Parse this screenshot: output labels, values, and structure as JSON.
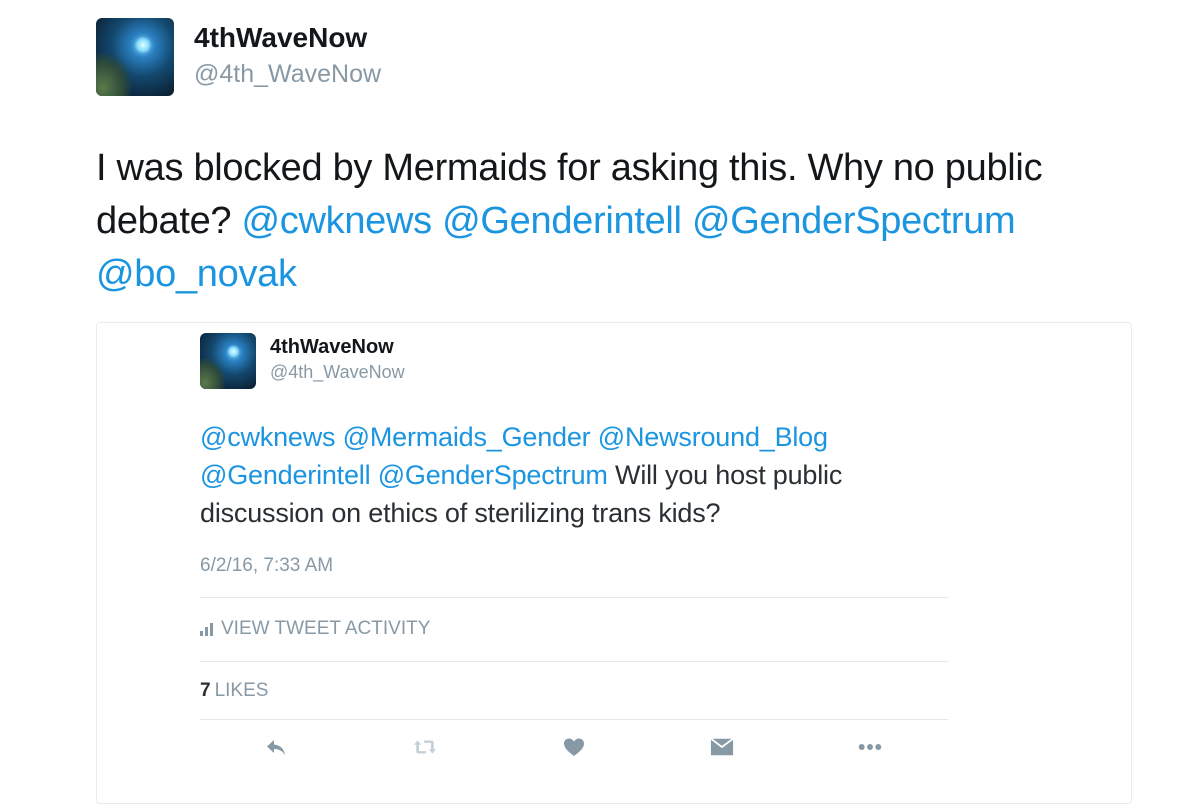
{
  "tweet": {
    "author_name": "4thWaveNow",
    "author_handle": "@4th_WaveNow",
    "text_line1": "I was blocked by Mermaids for asking this. Why no public",
    "text_line2_plain": "debate?",
    "mentions": [
      "@cwknews",
      "@Genderintell",
      "@GenderSpectrum",
      "@bo_novak"
    ]
  },
  "quoted_tweet": {
    "author_name": "4thWaveNow",
    "author_handle": "@4th_WaveNow",
    "mentions_line1": [
      "@cwknews",
      "@Mermaids_Gender",
      "@Newsround_Blog"
    ],
    "mentions_line2": [
      "@Genderintell",
      "@GenderSpectrum"
    ],
    "text_line2_tail": "Will you host public",
    "text_line3": "discussion on ethics of sterilizing trans kids?",
    "timestamp": "6/2/16, 7:33 AM",
    "activity_label": "VIEW TWEET ACTIVITY",
    "likes_count": "7",
    "likes_label": "LIKES"
  },
  "actions": [
    "reply-icon",
    "retweet-icon",
    "like-heart-icon",
    "direct-message-icon",
    "more-dots-icon"
  ],
  "colors": {
    "link": "#1b95e0",
    "muted": "#8899a6",
    "text": "#14171a",
    "divider": "#e1e8ed"
  }
}
